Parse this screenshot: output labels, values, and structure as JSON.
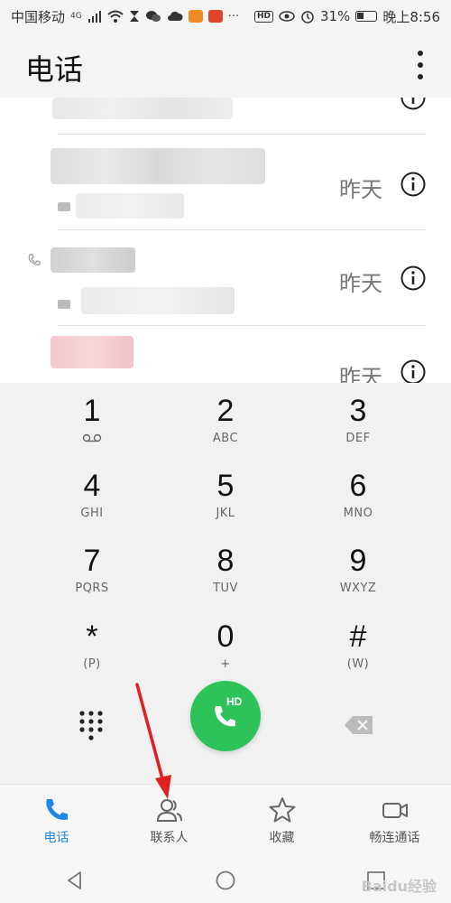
{
  "status_bar": {
    "carrier": "中国移动",
    "signal": "4G",
    "battery": "31%",
    "time": "晚上8:56"
  },
  "header": {
    "title": "电话"
  },
  "call_log": [
    {
      "time": "昨天"
    },
    {
      "time": "昨天"
    },
    {
      "time": "昨天"
    }
  ],
  "dialpad": {
    "keys": [
      {
        "digit": "1",
        "letters": ""
      },
      {
        "digit": "2",
        "letters": "ABC"
      },
      {
        "digit": "3",
        "letters": "DEF"
      },
      {
        "digit": "4",
        "letters": "GHI"
      },
      {
        "digit": "5",
        "letters": "JKL"
      },
      {
        "digit": "6",
        "letters": "MNO"
      },
      {
        "digit": "7",
        "letters": "PQRS"
      },
      {
        "digit": "8",
        "letters": "TUV"
      },
      {
        "digit": "9",
        "letters": "WXYZ"
      },
      {
        "digit": "*",
        "letters": "(P)"
      },
      {
        "digit": "0",
        "letters": "+"
      },
      {
        "digit": "#",
        "letters": "(W)"
      }
    ],
    "call_badge": "HD"
  },
  "tabs": [
    {
      "label": "电话",
      "icon": "phone-icon",
      "active": true
    },
    {
      "label": "联系人",
      "icon": "contacts-icon",
      "active": false
    },
    {
      "label": "收藏",
      "icon": "star-icon",
      "active": false
    },
    {
      "label": "畅连通话",
      "icon": "video-call-icon",
      "active": false
    }
  ],
  "colors": {
    "accent": "#1e88e5",
    "call_button": "#2ec25a",
    "annotation_arrow": "#e02020"
  },
  "watermark": "Baidu经验"
}
